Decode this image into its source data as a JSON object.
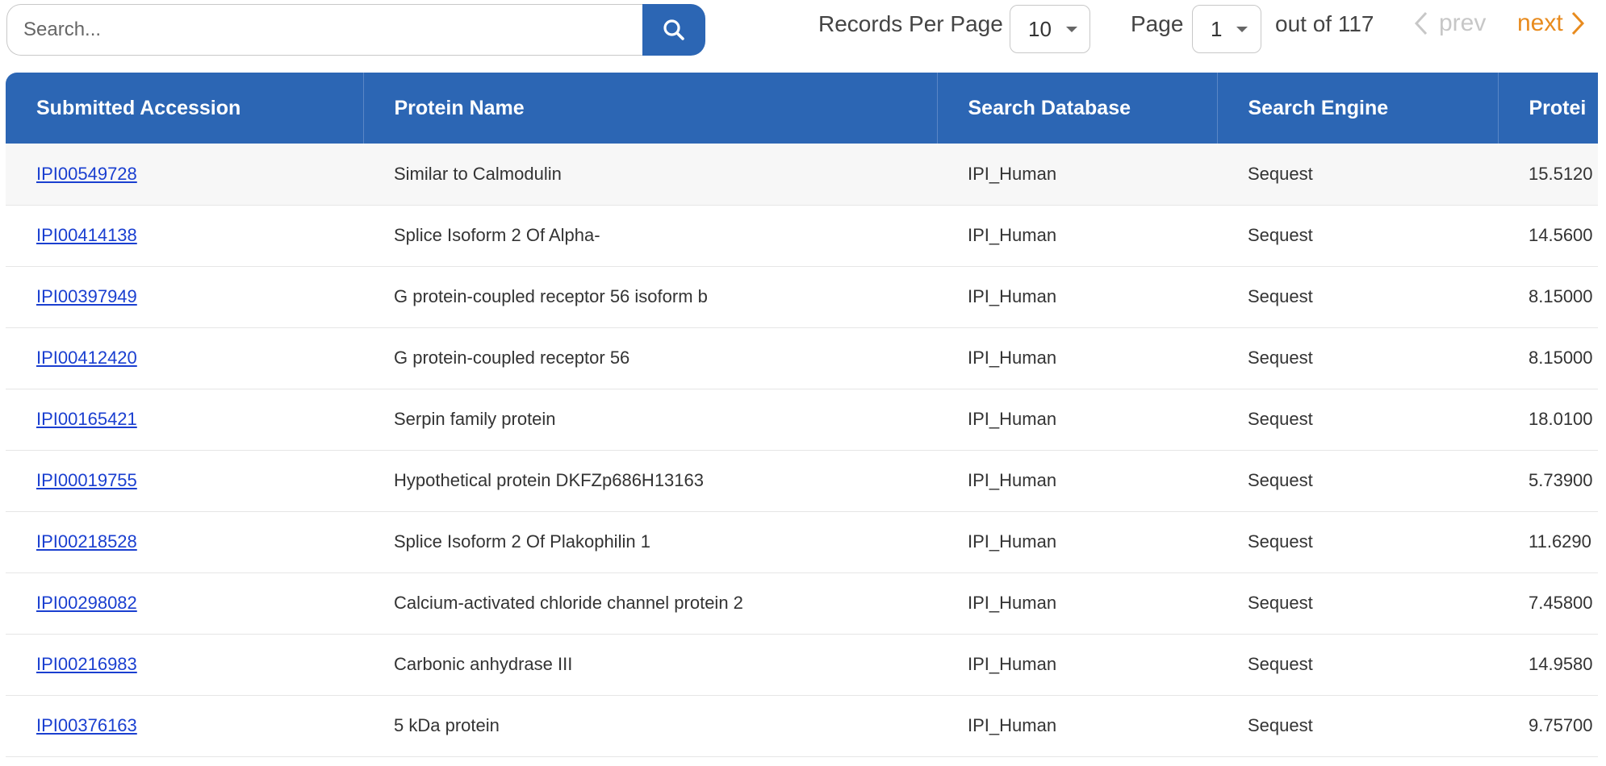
{
  "search": {
    "placeholder": "Search...",
    "button_icon": "search-icon"
  },
  "pagination": {
    "records_per_page_label": "Records Per Page",
    "records_per_page_value": "10",
    "page_label": "Page",
    "page_value": "1",
    "out_of_text": "out of 117",
    "prev_label": "prev",
    "next_label": "next"
  },
  "colors": {
    "header_bg": "#2c66b4",
    "link": "#1a3fd0",
    "next": "#e88b1e",
    "prev_disabled": "#c7c7c7"
  },
  "table": {
    "columns": [
      "Submitted Accession",
      "Protein Name",
      "Search Database",
      "Search Engine",
      "Protei"
    ],
    "rows": [
      {
        "accession": "IPI00549728",
        "protein_name": "Similar to Calmodulin",
        "database": "IPI_Human",
        "engine": "Sequest",
        "protein_value": "15.5120"
      },
      {
        "accession": "IPI00414138",
        "protein_name": "Splice Isoform 2 Of Alpha-",
        "database": "IPI_Human",
        "engine": "Sequest",
        "protein_value": "14.5600"
      },
      {
        "accession": "IPI00397949",
        "protein_name": "G protein-coupled receptor 56 isoform b",
        "database": "IPI_Human",
        "engine": "Sequest",
        "protein_value": "8.15000"
      },
      {
        "accession": "IPI00412420",
        "protein_name": "G protein-coupled receptor 56",
        "database": "IPI_Human",
        "engine": "Sequest",
        "protein_value": "8.15000"
      },
      {
        "accession": "IPI00165421",
        "protein_name": "Serpin family protein",
        "database": "IPI_Human",
        "engine": "Sequest",
        "protein_value": "18.0100"
      },
      {
        "accession": "IPI00019755",
        "protein_name": "Hypothetical protein DKFZp686H13163",
        "database": "IPI_Human",
        "engine": "Sequest",
        "protein_value": "5.73900"
      },
      {
        "accession": "IPI00218528",
        "protein_name": "Splice Isoform 2 Of Plakophilin 1",
        "database": "IPI_Human",
        "engine": "Sequest",
        "protein_value": "11.6290"
      },
      {
        "accession": "IPI00298082",
        "protein_name": "Calcium-activated chloride channel protein 2",
        "database": "IPI_Human",
        "engine": "Sequest",
        "protein_value": "7.45800"
      },
      {
        "accession": "IPI00216983",
        "protein_name": "Carbonic anhydrase III",
        "database": "IPI_Human",
        "engine": "Sequest",
        "protein_value": "14.9580"
      },
      {
        "accession": "IPI00376163",
        "protein_name": "5 kDa protein",
        "database": "IPI_Human",
        "engine": "Sequest",
        "protein_value": "9.75700"
      }
    ]
  }
}
